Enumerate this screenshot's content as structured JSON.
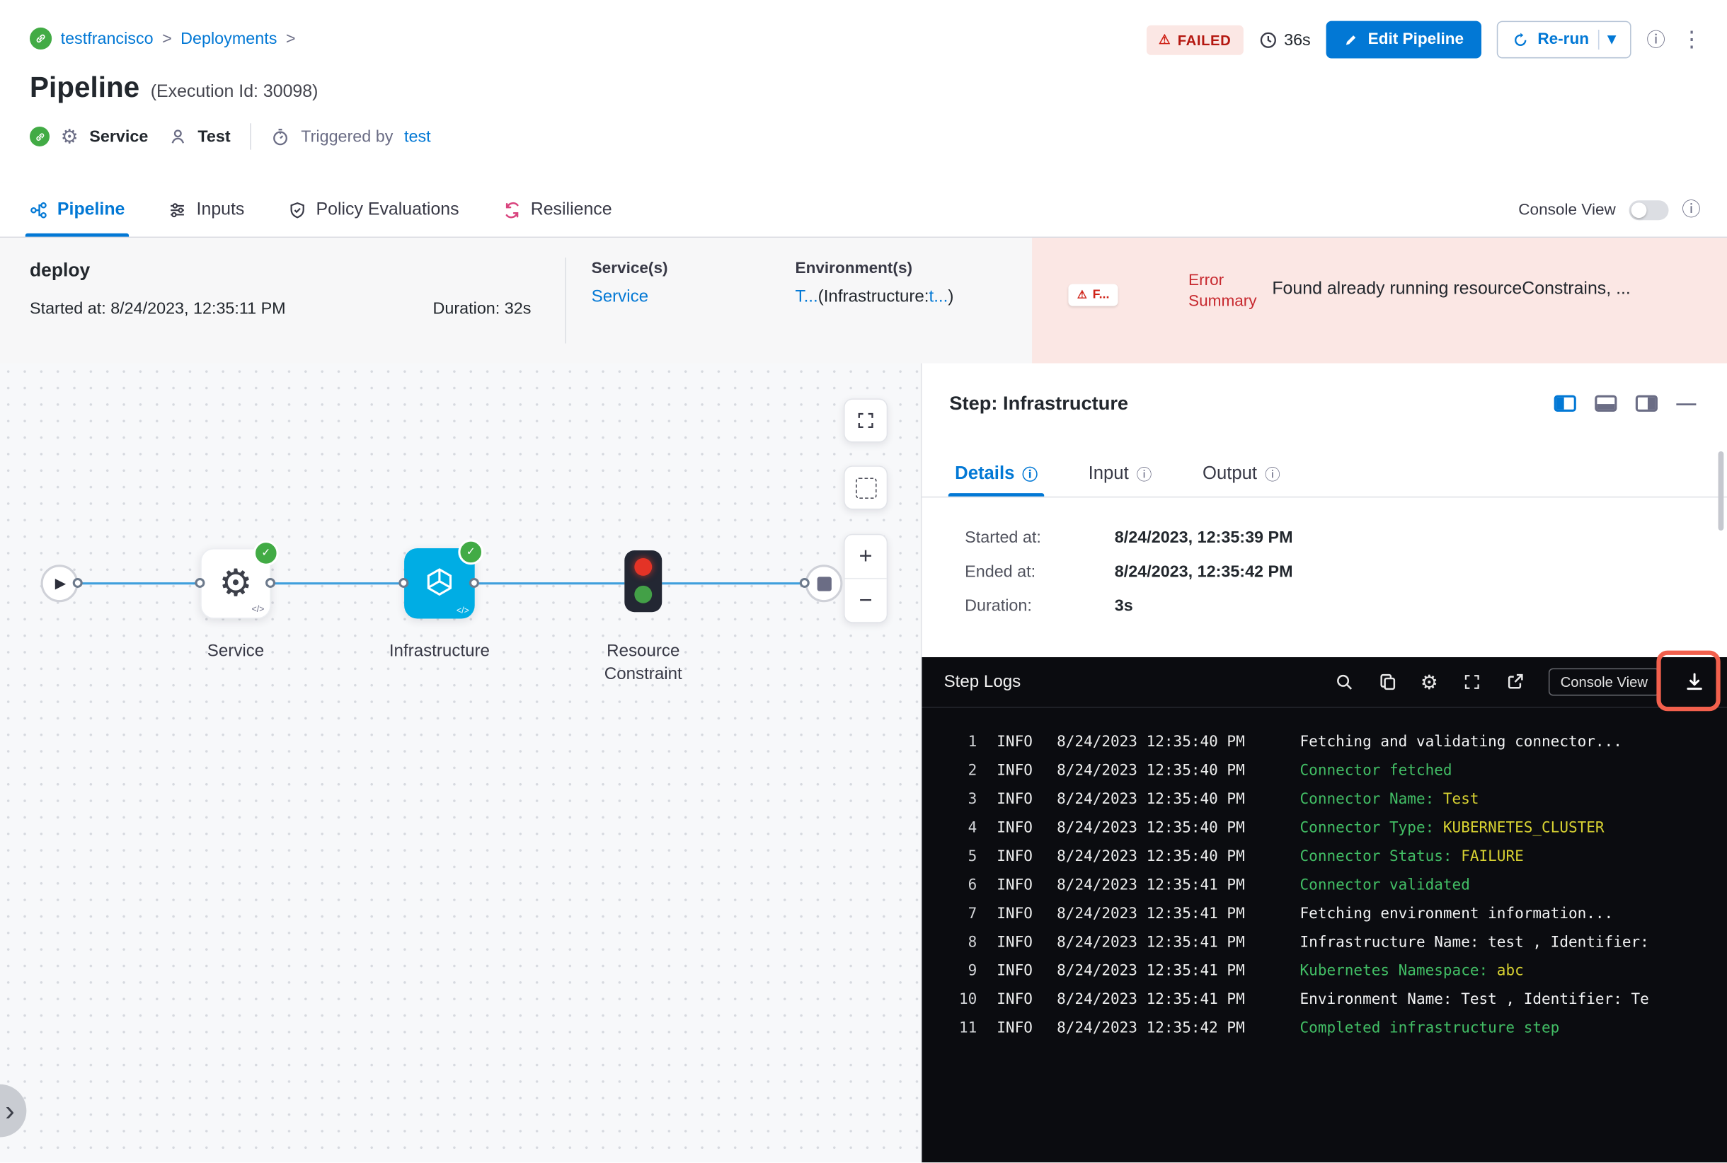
{
  "colors": {
    "accent": "#0278d5",
    "node-blue": "#00ade4",
    "success": "#42ab45",
    "danger": "#cf2318",
    "danger-bg": "#fbe7e4",
    "log-green": "#42be65",
    "log-yellow": "#d8d232",
    "annotation-red": "#f2604d"
  },
  "breadcrumb": {
    "project": "testfrancisco",
    "section": "Deployments",
    "separator": ">"
  },
  "header": {
    "status_badge": "FAILED",
    "elapsed": "36s",
    "edit_pipeline_label": "Edit Pipeline",
    "rerun_label": "Re-run",
    "rerun_caret": "▾",
    "title": "Pipeline",
    "execution_id": "(Execution Id: 30098)",
    "service_label": "Service",
    "user_label": "Test",
    "triggered_by_label": "Triggered by",
    "triggered_by_value": "test"
  },
  "tabs": [
    {
      "label": "Pipeline"
    },
    {
      "label": "Inputs"
    },
    {
      "label": "Policy Evaluations"
    },
    {
      "label": "Resilience"
    }
  ],
  "console_view_label": "Console View",
  "summary": {
    "stage_name": "deploy",
    "started": "Started at: 8/24/2023, 12:35:11 PM",
    "duration": "Duration: 32s",
    "services_label": "Service(s)",
    "services_value": "Service",
    "environments_label": "Environment(s)",
    "env_value_prefix": "T...",
    "env_value_infra": "(Infrastructure:",
    "env_value_suffix": "t...",
    "env_value_close": ")",
    "error_badge": "F...",
    "error_summary_label": "Error Summary",
    "error_text": "Found already running resourceConstrains, ..."
  },
  "graph": {
    "node1_label": "Service",
    "node2_label": "Infrastructure",
    "node3_label_line1": "Resource",
    "node3_label_line2": "Constraint",
    "code_badge": "</>"
  },
  "step_panel": {
    "title": "Step: Infrastructure",
    "tab_details": "Details",
    "tab_input": "Input",
    "tab_output": "Output",
    "started_label": "Started at:",
    "started_value": "8/24/2023, 12:35:39 PM",
    "ended_label": "Ended at:",
    "ended_value": "8/24/2023, 12:35:42 PM",
    "duration_label": "Duration:",
    "duration_value": "3s"
  },
  "logs": {
    "title": "Step Logs",
    "console_view_button": "Console View",
    "lines": [
      {
        "num": "1",
        "level": "INFO",
        "time": "8/24/2023 12:35:40 PM",
        "segments": [
          {
            "t": "Fetching and validating connector...",
            "c": "plain"
          }
        ]
      },
      {
        "num": "2",
        "level": "INFO",
        "time": "8/24/2023 12:35:40 PM",
        "segments": [
          {
            "t": "Connector fetched",
            "c": "key"
          }
        ]
      },
      {
        "num": "3",
        "level": "INFO",
        "time": "8/24/2023 12:35:40 PM",
        "segments": [
          {
            "t": "Connector Name: ",
            "c": "key"
          },
          {
            "t": "Test",
            "c": "val"
          }
        ]
      },
      {
        "num": "4",
        "level": "INFO",
        "time": "8/24/2023 12:35:40 PM",
        "segments": [
          {
            "t": "Connector Type: ",
            "c": "key"
          },
          {
            "t": "KUBERNETES_CLUSTER",
            "c": "val"
          }
        ]
      },
      {
        "num": "5",
        "level": "INFO",
        "time": "8/24/2023 12:35:40 PM",
        "segments": [
          {
            "t": "Connector Status: ",
            "c": "key"
          },
          {
            "t": "FAILURE",
            "c": "val"
          }
        ]
      },
      {
        "num": "6",
        "level": "INFO",
        "time": "8/24/2023 12:35:41 PM",
        "segments": [
          {
            "t": "Connector validated",
            "c": "key"
          }
        ]
      },
      {
        "num": "7",
        "level": "INFO",
        "time": "8/24/2023 12:35:41 PM",
        "segments": [
          {
            "t": "Fetching environment information...",
            "c": "plain"
          }
        ]
      },
      {
        "num": "8",
        "level": "INFO",
        "time": "8/24/2023 12:35:41 PM",
        "segments": [
          {
            "t": "Infrastructure Name: test , Identifier:",
            "c": "plain"
          }
        ]
      },
      {
        "num": "9",
        "level": "INFO",
        "time": "8/24/2023 12:35:41 PM",
        "segments": [
          {
            "t": "Kubernetes Namespace: ",
            "c": "key"
          },
          {
            "t": "abc",
            "c": "val"
          }
        ]
      },
      {
        "num": "10",
        "level": "INFO",
        "time": "8/24/2023 12:35:41 PM",
        "segments": [
          {
            "t": "Environment Name: Test , Identifier: Te",
            "c": "plain"
          }
        ]
      },
      {
        "num": "11",
        "level": "INFO",
        "time": "8/24/2023 12:35:42 PM",
        "segments": [
          {
            "t": "Completed infrastructure step",
            "c": "key"
          }
        ]
      }
    ]
  }
}
